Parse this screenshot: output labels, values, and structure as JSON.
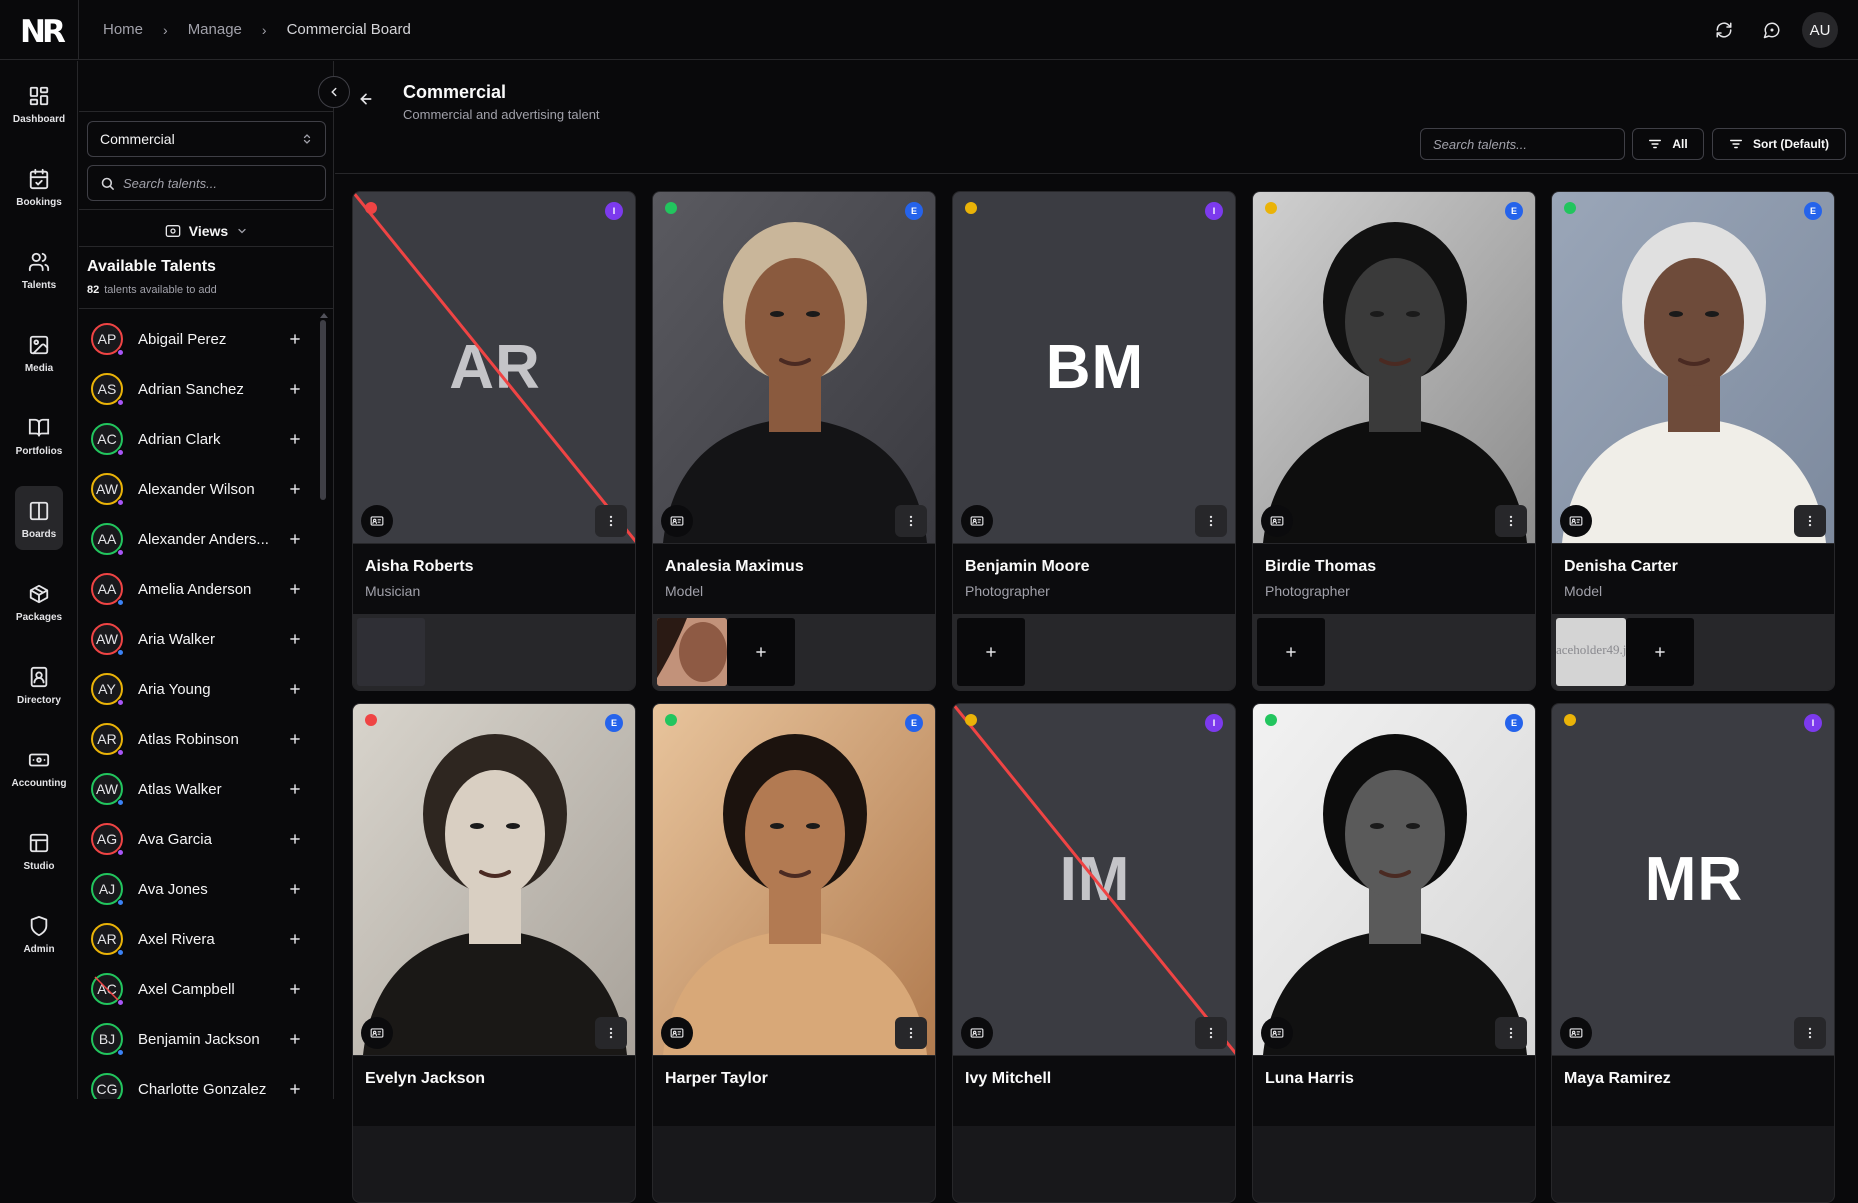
{
  "app": {
    "logo": "NR"
  },
  "breadcrumb": [
    "Home",
    "Manage",
    "Commercial Board"
  ],
  "user": {
    "initials": "AU"
  },
  "nav": [
    {
      "label": "Dashboard",
      "icon": "dashboard-icon"
    },
    {
      "label": "Bookings",
      "icon": "calendar-check-icon"
    },
    {
      "label": "Talents",
      "icon": "users-icon"
    },
    {
      "label": "Media",
      "icon": "image-icon"
    },
    {
      "label": "Portfolios",
      "icon": "book-open-icon"
    },
    {
      "label": "Boards",
      "icon": "columns-icon",
      "active": true
    },
    {
      "label": "Packages",
      "icon": "package-icon"
    },
    {
      "label": "Directory",
      "icon": "contact-book-icon"
    },
    {
      "label": "Accounting",
      "icon": "banknote-icon"
    },
    {
      "label": "Studio",
      "icon": "layout-icon"
    },
    {
      "label": "Admin",
      "icon": "shield-icon"
    }
  ],
  "panel": {
    "board_select": "Commercial",
    "search_placeholder": "Search talents...",
    "views_label": "Views",
    "title": "Available Talents",
    "count": "82",
    "count_suffix": "talents available to add",
    "talents": [
      {
        "initials": "AP",
        "name": "Abigail Perez",
        "ring": "#ef4444",
        "dot": "#a855f7"
      },
      {
        "initials": "AS",
        "name": "Adrian Sanchez",
        "ring": "#eab308",
        "dot": "#a855f7"
      },
      {
        "initials": "AC",
        "name": "Adrian Clark",
        "ring": "#22c55e",
        "dot": "#a855f7"
      },
      {
        "initials": "AW",
        "name": "Alexander Wilson",
        "ring": "#eab308",
        "dot": "#a855f7"
      },
      {
        "initials": "AA",
        "name": "Alexander Anders...",
        "ring": "#22c55e",
        "dot": "#a855f7"
      },
      {
        "initials": "AA",
        "name": "Amelia Anderson",
        "ring": "#ef4444",
        "dot": "#3b82f6"
      },
      {
        "initials": "AW",
        "name": "Aria Walker",
        "ring": "#ef4444",
        "dot": "#3b82f6"
      },
      {
        "initials": "AY",
        "name": "Aria Young",
        "ring": "#eab308",
        "dot": "#a855f7"
      },
      {
        "initials": "AR",
        "name": "Atlas Robinson",
        "ring": "#eab308",
        "dot": "#a855f7"
      },
      {
        "initials": "AW",
        "name": "Atlas Walker",
        "ring": "#22c55e",
        "dot": "#3b82f6"
      },
      {
        "initials": "AG",
        "name": "Ava Garcia",
        "ring": "#ef4444",
        "dot": "#a855f7"
      },
      {
        "initials": "AJ",
        "name": "Ava Jones",
        "ring": "#22c55e",
        "dot": "#3b82f6"
      },
      {
        "initials": "AR",
        "name": "Axel Rivera",
        "ring": "#eab308",
        "dot": "#3b82f6"
      },
      {
        "initials": "AC",
        "name": "Axel Campbell",
        "ring": "#22c55e",
        "dot": "#a855f7",
        "struck": true
      },
      {
        "initials": "BJ",
        "name": "Benjamin Jackson",
        "ring": "#22c55e",
        "dot": "#3b82f6"
      },
      {
        "initials": "CG",
        "name": "Charlotte Gonzalez",
        "ring": "#22c55e",
        "dot": "#3b82f6"
      }
    ]
  },
  "main": {
    "title": "Commercial",
    "subtitle": "Commercial and advertising talent",
    "search_placeholder": "Search talents...",
    "filter_label": "All",
    "sort_label": "Sort (Default)"
  },
  "cards": [
    {
      "name": "Aisha Roberts",
      "role": "Musician",
      "initials": "AR",
      "photo": false,
      "struck": true,
      "status": "#ef4444",
      "badge": "I",
      "strip": "empty"
    },
    {
      "name": "Analesia Maximus",
      "role": "Model",
      "photo": true,
      "tone": "dark-turtleneck",
      "status": "#22c55e",
      "badge": "E",
      "strip": "thumb-photo"
    },
    {
      "name": "Benjamin Moore",
      "role": "Photographer",
      "initials": "BM",
      "photo": false,
      "struck": false,
      "status": "#eab308",
      "badge": "I",
      "strip": "add"
    },
    {
      "name": "Birdie Thomas",
      "role": "Photographer",
      "photo": true,
      "tone": "bw-curly",
      "status": "#eab308",
      "badge": "E",
      "strip": "add"
    },
    {
      "name": "Denisha Carter",
      "role": "Model",
      "photo": true,
      "tone": "white-top",
      "status": "#22c55e",
      "badge": "E",
      "strip": "thumb-placeholder",
      "placeholder_text": "aceholder49.j"
    },
    {
      "name": "Evelyn Jackson",
      "role": "",
      "photo": true,
      "tone": "sepia-hair",
      "status": "#ef4444",
      "badge": "E"
    },
    {
      "name": "Harper Taylor",
      "role": "",
      "photo": true,
      "tone": "warm-curly",
      "status": "#22c55e",
      "badge": "E"
    },
    {
      "name": "Ivy Mitchell",
      "role": "",
      "initials": "IM",
      "photo": false,
      "struck": true,
      "status": "#eab308",
      "badge": "I"
    },
    {
      "name": "Luna Harris",
      "role": "",
      "photo": true,
      "tone": "bw-afro",
      "status": "#22c55e",
      "badge": "E"
    },
    {
      "name": "Maya Ramirez",
      "role": "",
      "initials": "MR",
      "photo": false,
      "struck": false,
      "status": "#eab308",
      "badge": "I"
    }
  ],
  "colors": {
    "badge_I": "#7c3aed",
    "badge_E": "#2563eb",
    "strike": "#ef4444"
  }
}
